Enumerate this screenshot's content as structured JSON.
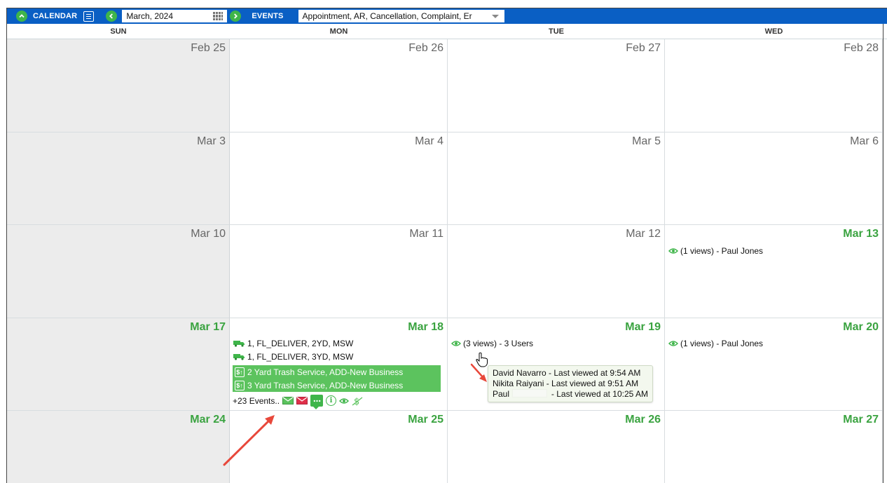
{
  "toolbar": {
    "calendar_label": "CALENDAR",
    "month_value": "March, 2024",
    "events_label": "EVENTS",
    "events_filter_value": "Appointment, AR, Cancellation, Complaint, Er"
  },
  "weekdays": [
    "SUN",
    "MON",
    "TUE",
    "WED"
  ],
  "weeks": [
    [
      "Feb 25",
      "Feb 26",
      "Feb 27",
      "Feb 28"
    ],
    [
      "Mar 3",
      "Mar 4",
      "Mar 5",
      "Mar 6"
    ],
    [
      "Mar 10",
      "Mar 11",
      "Mar 12",
      "Mar 13"
    ],
    [
      "Mar 17",
      "Mar 18",
      "Mar 19",
      "Mar 20"
    ],
    [
      "Mar 24",
      "Mar 25",
      "Mar 26",
      "Mar 27"
    ]
  ],
  "events": {
    "mar13_views": "(1 views) - Paul Jones",
    "mar18_truck_1": "1, FL_DELIVER, 2YD, MSW",
    "mar18_truck_2": "1, FL_DELIVER, 3YD, MSW",
    "mar18_bar_1": "2 Yard Trash Service, ADD-New Business",
    "mar18_bar_2": "3 Yard Trash Service, ADD-New Business",
    "mar18_more": "+23 Events..",
    "mar19_views": "(3 views) - 3 Users",
    "mar20_views": "(1 views) - Paul Jones"
  },
  "tooltip": {
    "row1": "David Navarro - Last viewed at 9:54 AM",
    "row2": "Nikita Raiyani - Last viewed at 9:51 AM",
    "row3_name": "Paul",
    "row3_rest": "- Last viewed at 10:25 AM"
  },
  "colors": {
    "toolbar": "#0a5fc4",
    "accent_green": "#3fb54a",
    "event_bar": "#5cc35e",
    "current_month_date": "#3aa340",
    "annotation_arrow": "#e8483b"
  },
  "icons": [
    "chevron-up-icon",
    "list-icon",
    "chevron-left-icon",
    "calendar-grid-icon",
    "chevron-right-icon",
    "dropdown-arrow-icon",
    "eye-icon",
    "truck-icon",
    "dollar-icon",
    "mail-icon",
    "mail-unread-icon",
    "chat-icon",
    "info-icon",
    "view-icon",
    "no-dollar-icon",
    "hand-cursor-icon"
  ]
}
